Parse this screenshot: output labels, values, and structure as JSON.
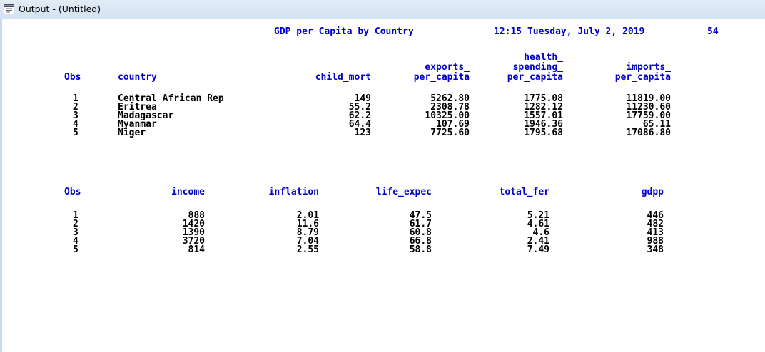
{
  "window": {
    "title": "Output - (Untitled)"
  },
  "header": {
    "title": "GDP per Capita by Country",
    "timestamp": "12:15 Tuesday, July 2, 2019",
    "page_number": "54"
  },
  "table1": {
    "columns": [
      "Obs",
      "country",
      "child_mort",
      "exports_\nper_capita",
      "health_\nspending_\nper_capita",
      "imports_\nper_capita"
    ],
    "rows": [
      [
        "1",
        "Central African Rep",
        "149",
        "5262.80",
        "1775.08",
        "11819.00"
      ],
      [
        "2",
        "Eritrea",
        "55.2",
        "2308.78",
        "1282.12",
        "11230.60"
      ],
      [
        "3",
        "Madagascar",
        "62.2",
        "10325.00",
        "1557.01",
        "17759.00"
      ],
      [
        "4",
        "Myanmar",
        "64.4",
        "107.69",
        "1946.36",
        "65.11"
      ],
      [
        "5",
        "Niger",
        "123",
        "7725.60",
        "1795.68",
        "17086.80"
      ]
    ]
  },
  "table2": {
    "columns": [
      "Obs",
      "income",
      "inflation",
      "life_expec",
      "total_fer",
      "gdpp"
    ],
    "rows": [
      [
        "1",
        "888",
        "2.01",
        "47.5",
        "5.21",
        "446"
      ],
      [
        "2",
        "1420",
        "11.6",
        "61.7",
        "4.61",
        "482"
      ],
      [
        "3",
        "1390",
        "8.79",
        "60.8",
        "4.6",
        "413"
      ],
      [
        "4",
        "3720",
        "7.04",
        "66.8",
        "2.41",
        "988"
      ],
      [
        "5",
        "814",
        "2.55",
        "58.8",
        "7.49",
        "348"
      ]
    ]
  }
}
